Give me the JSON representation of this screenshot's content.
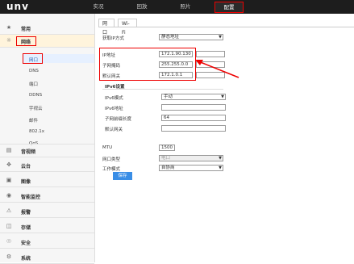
{
  "header": {
    "logo": "unv",
    "nav": [
      "实况",
      "回放",
      "照片",
      "配置"
    ],
    "active": "配置"
  },
  "sidebar": {
    "items": [
      {
        "label": "常用",
        "icon": "star-icon"
      },
      {
        "label": "网络",
        "icon": "globe-icon"
      },
      {
        "label": "音视频",
        "icon": "film-icon"
      },
      {
        "label": "云台",
        "icon": "ptz-icon"
      },
      {
        "label": "图像",
        "icon": "image-icon"
      },
      {
        "label": "智能监控",
        "icon": "eye-icon"
      },
      {
        "label": "报警",
        "icon": "alarm-icon"
      },
      {
        "label": "存储",
        "icon": "storage-icon"
      },
      {
        "label": "安全",
        "icon": "shield-icon"
      },
      {
        "label": "系统",
        "icon": "system-icon"
      }
    ],
    "network_sub": [
      "网口",
      "DNS",
      "端口",
      "DDNS",
      "宇视云",
      "邮件",
      "802.1x",
      "QoS"
    ]
  },
  "tabs": [
    "网口",
    "Wi-Fi"
  ],
  "form": {
    "ip_mode_label": "获取IP方式",
    "ip_mode_value": "静态地址",
    "ip_label": "IP地址",
    "ip_value": "172.1.90.130",
    "mask_label": "子网掩码",
    "mask_value": "255.255.0.0",
    "gw_label": "默认网关",
    "gw_value": "172.1.0.1",
    "ipv6_section": "IPv6设置",
    "ipv6_mode_label": "IPv6模式",
    "ipv6_mode_value": "手动",
    "ipv6_addr_label": "IPv6地址",
    "ipv6_addr_value": "",
    "prefix_label": "子网前缀长度",
    "prefix_value": "64",
    "ipv6_gw_label": "默认网关",
    "ipv6_gw_value": "",
    "mtu_label": "MTU",
    "mtu_value": "1500",
    "port_type_label": "网口类型",
    "port_type_value": "电口",
    "work_mode_label": "工作模式",
    "work_mode_value": "自协商",
    "save_label": "保存"
  }
}
